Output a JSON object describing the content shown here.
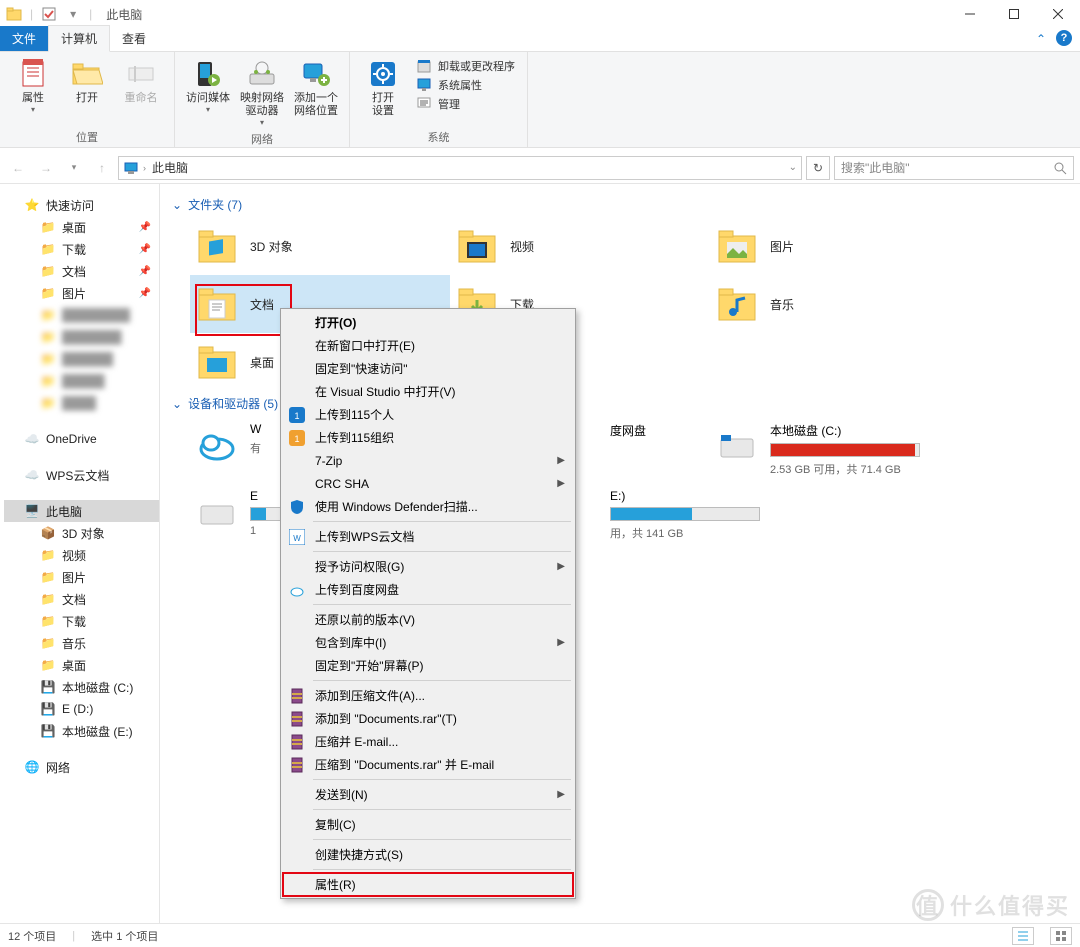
{
  "title": "此电脑",
  "tabs": {
    "file": "文件",
    "computer": "计算机",
    "view": "查看"
  },
  "ribbon": {
    "groups": {
      "location": {
        "label": "位置",
        "items": {
          "properties": "属性",
          "open": "打开",
          "rename": "重命名"
        }
      },
      "network": {
        "label": "网络",
        "items": {
          "media": "访问媒体",
          "map": "映射网络\n驱动器",
          "addloc": "添加一个\n网络位置"
        }
      },
      "system": {
        "label": "系统",
        "items": {
          "opensettings": "打开\n设置"
        },
        "links": {
          "uninstall": "卸载或更改程序",
          "sysprop": "系统属性",
          "manage": "管理"
        }
      }
    }
  },
  "addr": {
    "location": "此电脑"
  },
  "search": {
    "placeholder": "搜索\"此电脑\""
  },
  "nav": {
    "quick": "快速访问",
    "quick_items": [
      "桌面",
      "下载",
      "文档",
      "图片"
    ],
    "onedrive": "OneDrive",
    "wps": "WPS云文档",
    "thispc": "此电脑",
    "pc_items": [
      "3D 对象",
      "视频",
      "图片",
      "文档",
      "下载",
      "音乐",
      "桌面",
      "本地磁盘 (C:)",
      "E (D:)",
      "本地磁盘 (E:)"
    ],
    "network": "网络"
  },
  "sections": {
    "folders": {
      "label": "文件夹 (7)",
      "items": [
        "3D 对象",
        "视频",
        "图片",
        "文档",
        "下载",
        "音乐",
        "桌面"
      ]
    },
    "drives": {
      "label": "设备和驱动器 (5)",
      "items": [
        {
          "name": "W",
          "sub": "有",
          "type": "cloud"
        },
        {
          "name": "度网盘",
          "type": "baidu"
        },
        {
          "name": "本地磁盘 (C:)",
          "sub": "2.53 GB 可用，共 71.4 GB",
          "fill": 0.97,
          "color": "#d92a1c"
        },
        {
          "name": "E",
          "sub": "1",
          "type": "drive"
        },
        {
          "name": "E:)",
          "sub": "用，共 141 GB",
          "fill": 0.55,
          "color": "#26a0da",
          "type": "drive"
        }
      ]
    }
  },
  "context_menu": [
    {
      "t": "打开(O)",
      "bold": true
    },
    {
      "t": "在新窗口中打开(E)"
    },
    {
      "t": "固定到\"快速访问\""
    },
    {
      "t": "在 Visual Studio 中打开(V)"
    },
    {
      "t": "上传到115个人",
      "icon": "115b"
    },
    {
      "t": "上传到115组织",
      "icon": "115o"
    },
    {
      "t": "7-Zip",
      "sub": true
    },
    {
      "t": "CRC SHA",
      "sub": true
    },
    {
      "t": "使用 Windows Defender扫描...",
      "icon": "shield"
    },
    {
      "sep": true
    },
    {
      "t": "上传到WPS云文档",
      "icon": "wps"
    },
    {
      "sep": true
    },
    {
      "t": "授予访问权限(G)",
      "sub": true
    },
    {
      "t": "上传到百度网盘",
      "icon": "baidu"
    },
    {
      "sep": true
    },
    {
      "t": "还原以前的版本(V)"
    },
    {
      "t": "包含到库中(I)",
      "sub": true
    },
    {
      "t": "固定到\"开始\"屏幕(P)"
    },
    {
      "sep": true
    },
    {
      "t": "添加到压缩文件(A)...",
      "icon": "rar"
    },
    {
      "t": "添加到 \"Documents.rar\"(T)",
      "icon": "rar"
    },
    {
      "t": "压缩并 E-mail...",
      "icon": "rar"
    },
    {
      "t": "压缩到 \"Documents.rar\" 并 E-mail",
      "icon": "rar"
    },
    {
      "sep": true
    },
    {
      "t": "发送到(N)",
      "sub": true
    },
    {
      "sep": true
    },
    {
      "t": "复制(C)"
    },
    {
      "sep": true
    },
    {
      "t": "创建快捷方式(S)"
    },
    {
      "sep": true
    },
    {
      "t": "属性(R)",
      "boxed": true
    }
  ],
  "status": {
    "count": "12 个项目",
    "selected": "选中 1 个项目"
  },
  "watermark": "什么值得买"
}
